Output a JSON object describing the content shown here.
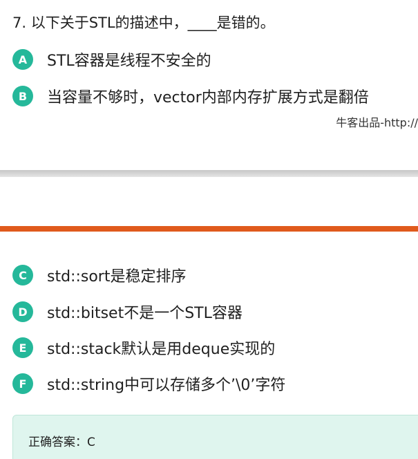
{
  "question": {
    "text": "7. 以下关于STL的描述中，____是错的。"
  },
  "options_top": [
    {
      "letter": "A",
      "text": "STL容器是线程不安全的"
    },
    {
      "letter": "B",
      "text": "当容量不够时，vector内部内存扩展方式是翻倍"
    }
  ],
  "watermark": {
    "text": "牛客出品-http://"
  },
  "options_bottom": [
    {
      "letter": "C",
      "text": "std::sort是稳定排序"
    },
    {
      "letter": "D",
      "text": "std::bitset不是一个STL容器"
    },
    {
      "letter": "E",
      "text": "std::stack默认是用deque实现的"
    },
    {
      "letter": "F",
      "text": "std::string中可以存储多个’\\0’字符"
    }
  ],
  "answer": {
    "text": "正确答案：C"
  },
  "colors": {
    "badge": "#25b89a",
    "orange_band": "#e05a1c",
    "answer_bg": "#dff5ee"
  }
}
